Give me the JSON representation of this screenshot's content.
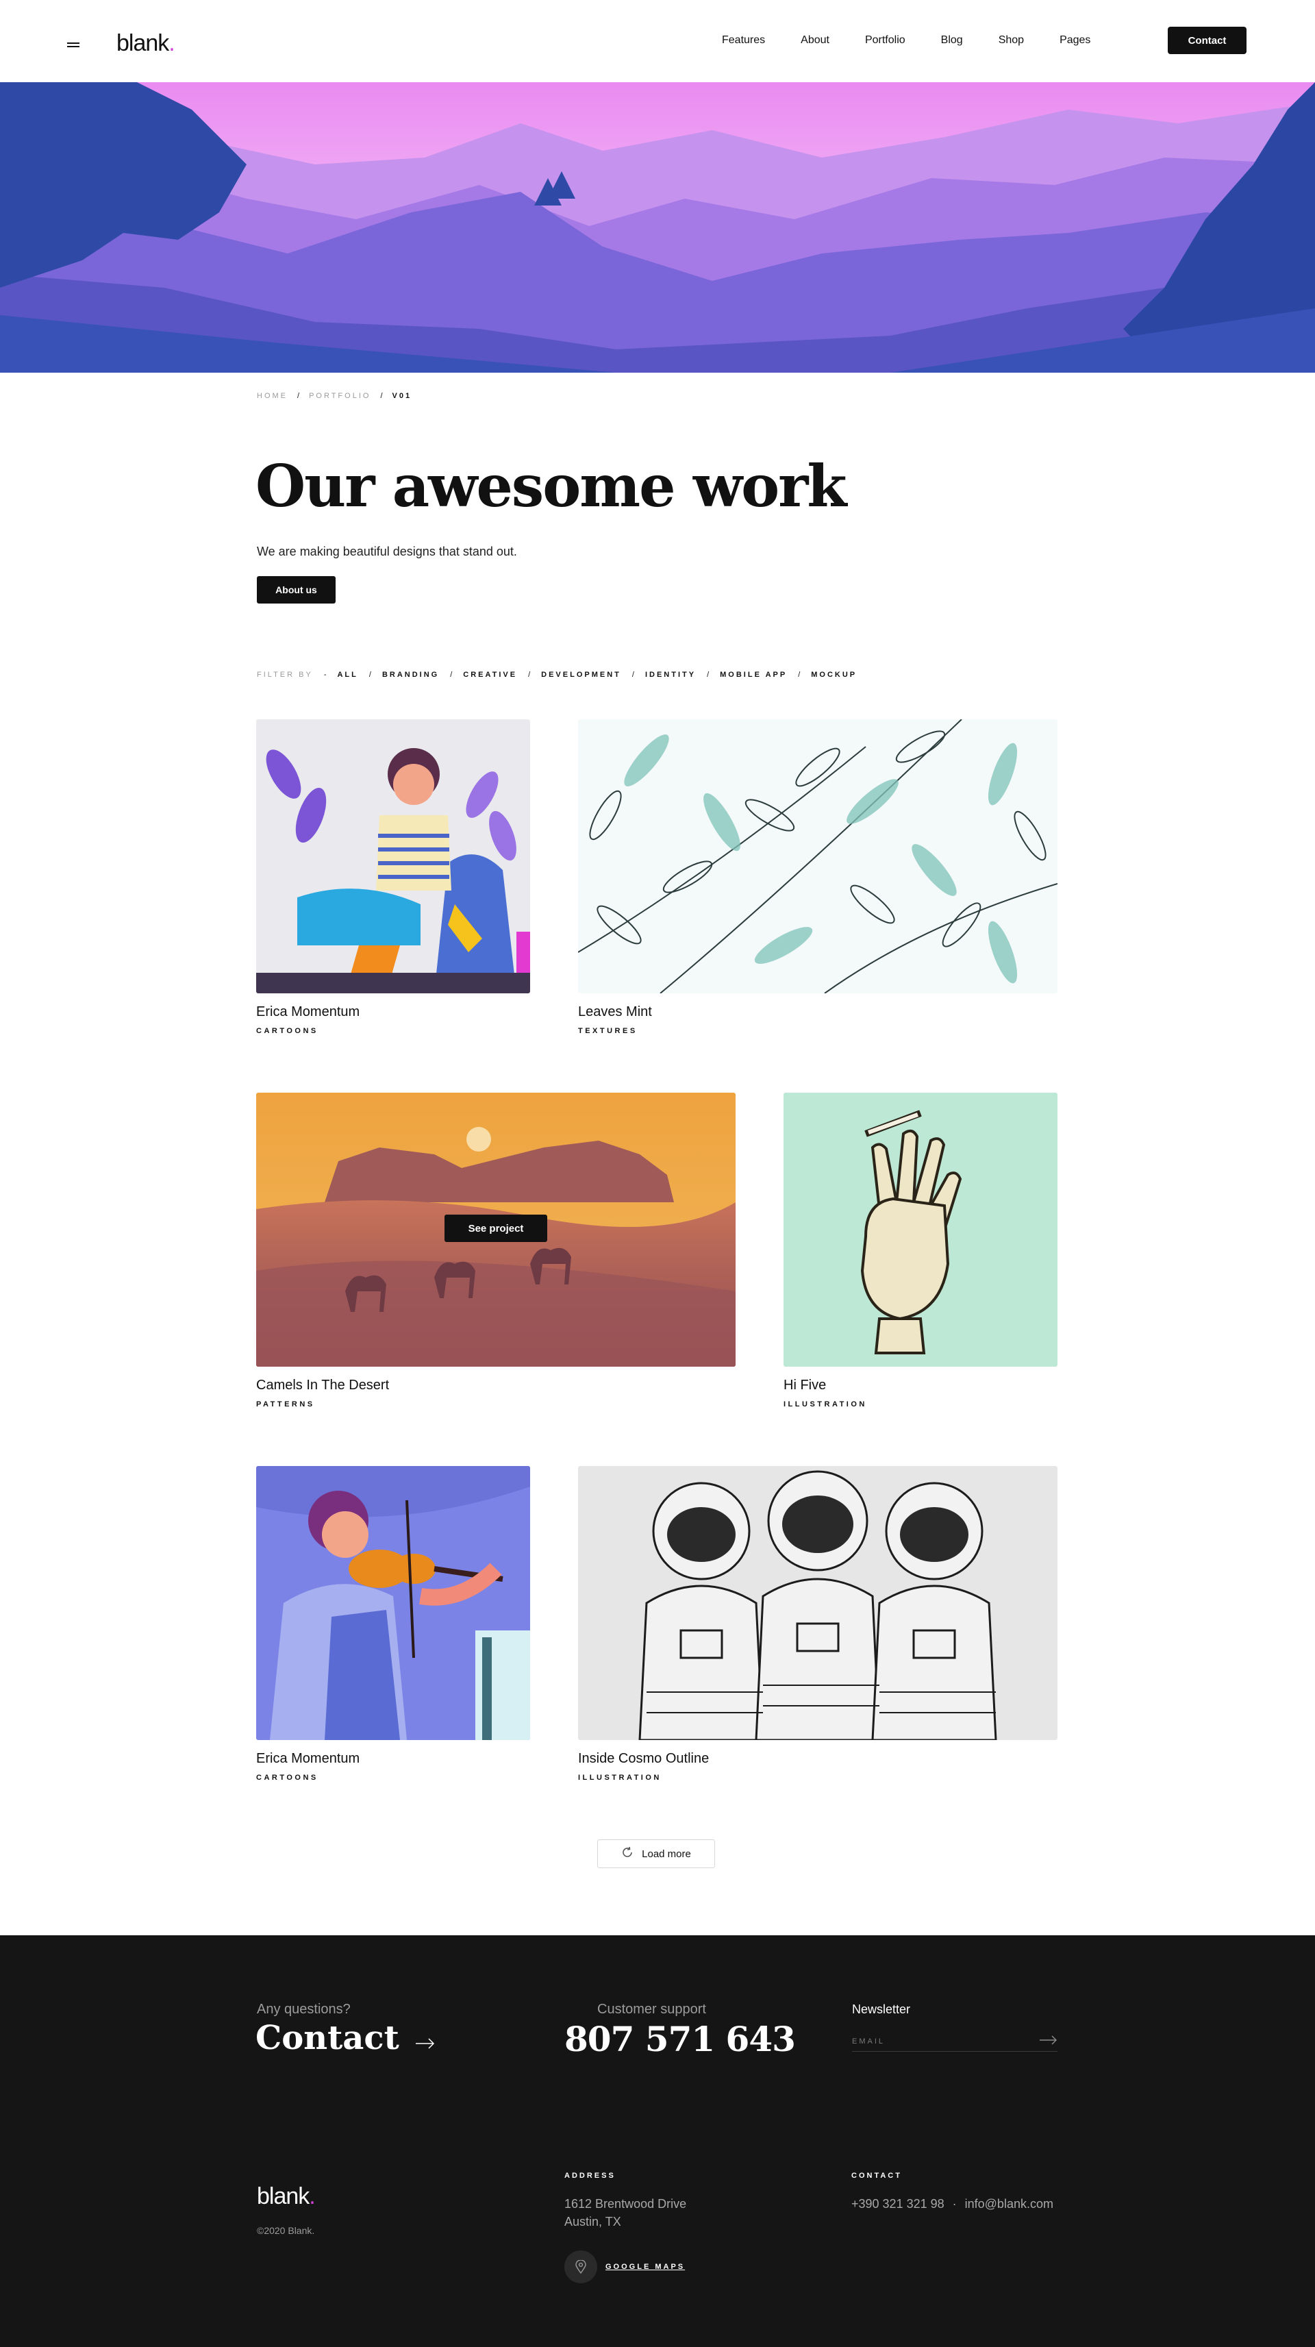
{
  "header": {
    "logo": "blank",
    "logo_dot": ".",
    "nav": [
      "Features",
      "About",
      "Portfolio",
      "Blog",
      "Shop",
      "Pages"
    ],
    "contact_label": "Contact"
  },
  "breadcrumb": {
    "home": "HOME",
    "portfolio": "PORTFOLIO",
    "current": "V01",
    "separator": "/"
  },
  "page": {
    "title": "Our awesome work",
    "intro": "We are making beautiful designs that stand out.",
    "about_label": "About us"
  },
  "filter": {
    "label": "FILTER BY",
    "dash": "-",
    "separator": "/",
    "items": [
      "ALL",
      "BRANDING",
      "CREATIVE",
      "DEVELOPMENT",
      "IDENTITY",
      "MOBILE APP",
      "MOCKUP"
    ]
  },
  "projects": [
    {
      "title": "Erica Momentum",
      "category": "CARTOONS"
    },
    {
      "title": "Leaves Mint",
      "category": "TEXTURES"
    },
    {
      "title": "Camels In The Desert",
      "category": "PATTERNS",
      "hover_label": "See project"
    },
    {
      "title": "Hi Five",
      "category": "ILLUSTRATION"
    },
    {
      "title": "Erica Momentum",
      "category": "CARTOONS"
    },
    {
      "title": "Inside Cosmo Outline",
      "category": "ILLUSTRATION"
    }
  ],
  "load_more": "Load more",
  "footer": {
    "questions": "Any questions?",
    "contact": "Contact",
    "support_label": "Customer support",
    "phone": "807 571 643",
    "newsletter": "Newsletter",
    "email_placeholder": "EMAIL",
    "logo": "blank",
    "logo_dot": ".",
    "copyright": "©2020 Blank.",
    "address_heading": "ADDRESS",
    "address_line1": "1612  Brentwood Drive",
    "address_line2": "Austin, TX",
    "maps_link": "GOOGLE MAPS",
    "contact_heading": "CONTACT",
    "contact_phone": "+390 321 321 98",
    "contact_dot": "·",
    "contact_email": "info@blank.com"
  },
  "colors": {
    "accent": "#d43fd8",
    "dark": "#151515",
    "button": "#111111"
  }
}
